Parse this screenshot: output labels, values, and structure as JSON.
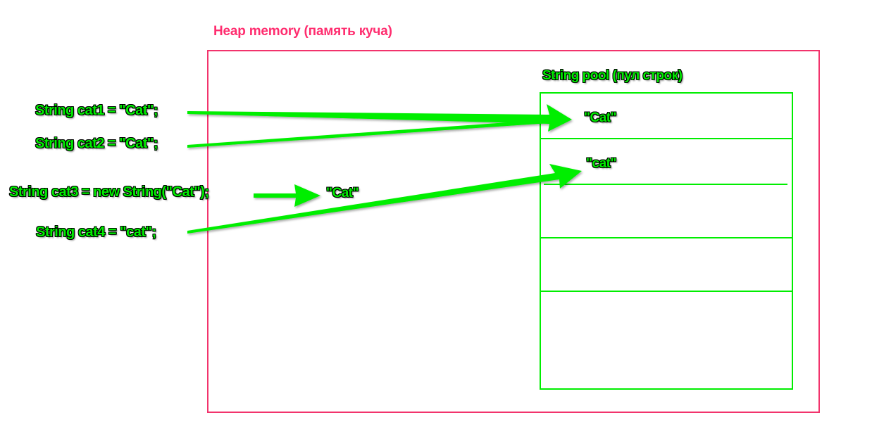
{
  "heap": {
    "title": "Heap memory (память куча)"
  },
  "pool": {
    "title": "String pool (пул строк)",
    "entries": [
      "\"Cat\"",
      "\"cat\""
    ]
  },
  "heap_object": "\"Cat\"",
  "code_lines": [
    "String cat1 = \"Cat\";",
    "String cat2 = \"Cat\";",
    "String cat3 = new String(\"Cat\");",
    "String cat4 = \"cat\";"
  ],
  "colors": {
    "heap_border": "#f2336c",
    "heap_title": "#ff2d6f",
    "green": "#00ee00",
    "outline": "#000000"
  }
}
